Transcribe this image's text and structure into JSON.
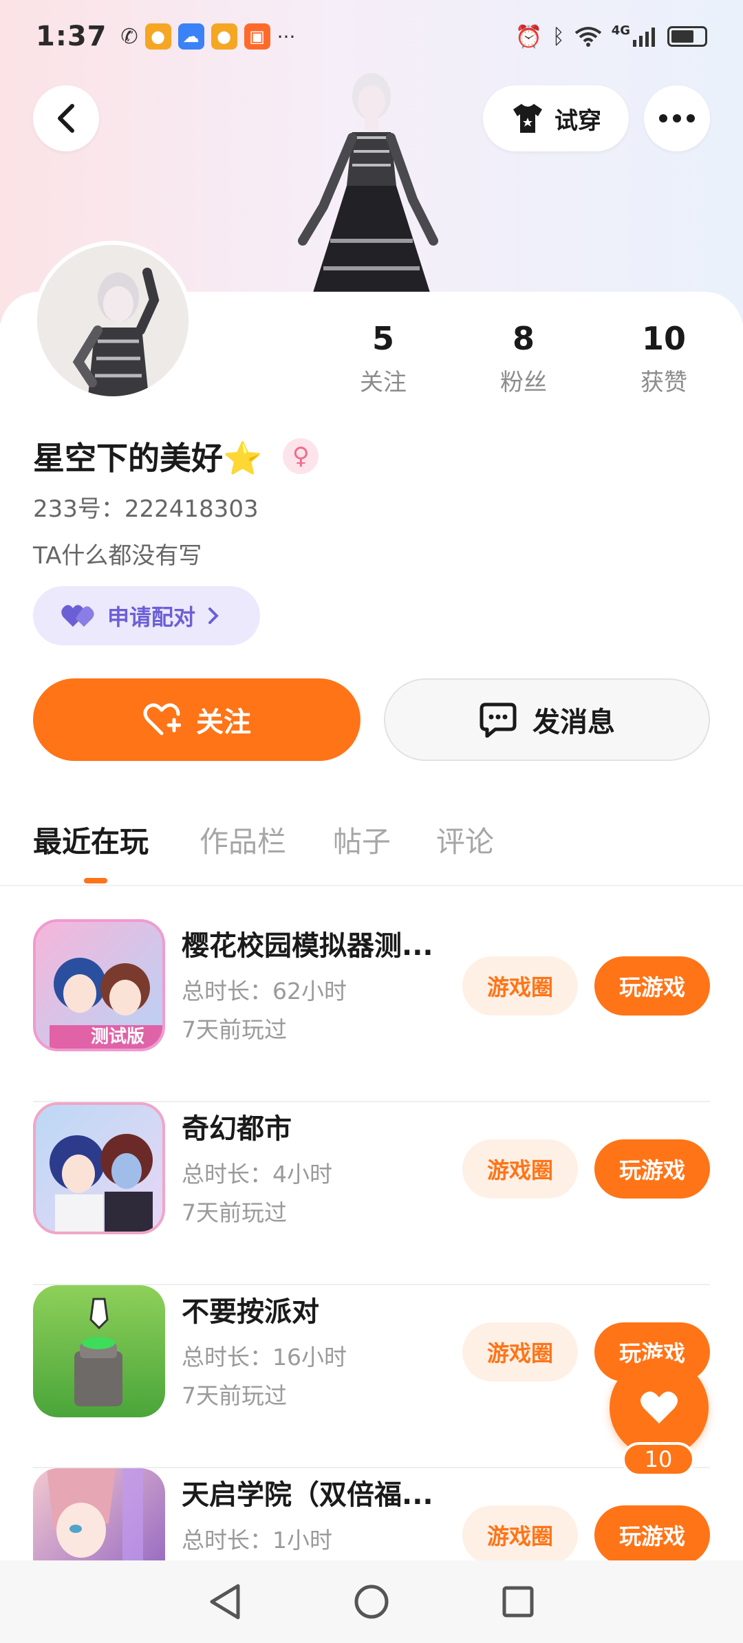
{
  "status_bar": {
    "time": "1:37",
    "ellipsis": "···",
    "network": "4G"
  },
  "header": {
    "try_on_label": "试穿"
  },
  "profile": {
    "stats": [
      {
        "value": "5",
        "label": "关注"
      },
      {
        "value": "8",
        "label": "粉丝"
      },
      {
        "value": "10",
        "label": "获赞"
      }
    ],
    "name": "星空下的美好⭐",
    "gender_symbol": "♀",
    "uid": "233号：222418303",
    "bio": "TA什么都没有写",
    "pair_label": "申请配对"
  },
  "actions": {
    "follow_label": "关注",
    "message_label": "发消息"
  },
  "tabs": [
    {
      "label": "最近在玩",
      "active": true
    },
    {
      "label": "作品栏",
      "active": false
    },
    {
      "label": "帖子",
      "active": false
    },
    {
      "label": "评论",
      "active": false
    }
  ],
  "games": [
    {
      "name": "樱花校园模拟器测...",
      "duration": "总时长：62小时",
      "last_played": "7天前玩过",
      "icon": "sakura-school-test-icon",
      "icon_badge": "测试版"
    },
    {
      "name": "奇幻都市",
      "duration": "总时长：4小时",
      "last_played": "7天前玩过",
      "icon": "fantasy-city-icon"
    },
    {
      "name": "不要按派对",
      "duration": "总时长：16小时",
      "last_played": "7天前玩过",
      "icon": "dont-press-party-icon"
    },
    {
      "name": "天启学院（双倍福...",
      "duration": "总时长：1小时",
      "last_played": "",
      "icon": "tianqi-academy-icon"
    }
  ],
  "game_buttons": {
    "circle_label": "游戏圈",
    "play_label": "玩游戏"
  },
  "like_fab": {
    "count": "10"
  },
  "colors": {
    "accent": "#ff7417",
    "accent_light": "#fff0e6",
    "pair_bg": "#ebe9fb",
    "pair_text": "#6c5fd6"
  }
}
